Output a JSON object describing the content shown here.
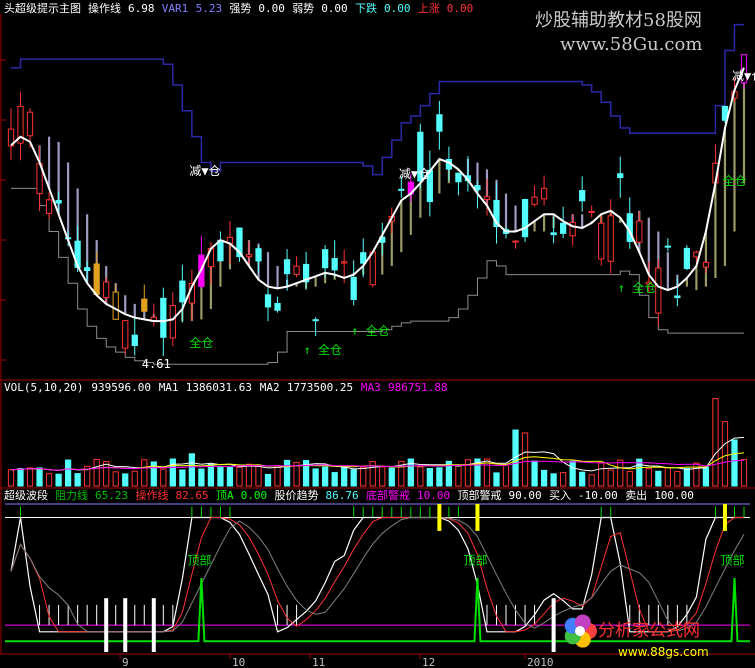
{
  "colors": {
    "background": "#000000",
    "up": "#ff3232",
    "down": "#54ffff",
    "main_line": "#ffffff",
    "stop_line": "#2a2aa8",
    "support_line": "#8c8c8c",
    "ribbon_down": "#b9b9e6",
    "ribbon_up": "#b5b57a",
    "signal_pink": "#ff00ff",
    "signal_gold": "#e0a020",
    "green": "#00e000",
    "yellow": "#ffff00",
    "panel_frame": "#a00000"
  },
  "main_panel": {
    "header": [
      {
        "text": "头超级提示主图",
        "color": "#ffffff"
      },
      {
        "text": "操作线",
        "color": "#ffffff"
      },
      {
        "text": "6.98",
        "color": "#ffffff"
      },
      {
        "text": "VAR1",
        "color": "#8080ff"
      },
      {
        "text": "5.23",
        "color": "#8080ff"
      },
      {
        "text": "强势",
        "color": "#ffffff"
      },
      {
        "text": "0.00",
        "color": "#ffffff"
      },
      {
        "text": "弱势",
        "color": "#ffffff"
      },
      {
        "text": "0.00",
        "color": "#ffffff"
      },
      {
        "text": "下跌",
        "color": "#54ffff"
      },
      {
        "text": "0.00",
        "color": "#54ffff"
      },
      {
        "text": "上涨",
        "color": "#ff3232"
      },
      {
        "text": "0.00",
        "color": "#ff3232"
      }
    ],
    "annotations": [
      {
        "text": "减▼仓",
        "color": "#ffffff"
      },
      {
        "text": "减▼仓",
        "color": "#ffffff"
      },
      {
        "text": "减▼仓",
        "color": "#ffffff"
      },
      {
        "text": "全仓",
        "color": "#00e000"
      },
      {
        "text": "↑ 全仓",
        "color": "#00e000"
      },
      {
        "text": "↑ 全仓",
        "color": "#00e000"
      },
      {
        "text": "↑ 全仓",
        "color": "#00e000"
      },
      {
        "text": "全仓",
        "color": "#00e000"
      },
      {
        "text": "4.61",
        "color": "#ffffff"
      }
    ]
  },
  "volume_panel": {
    "header": [
      {
        "text": "VOL(5,10,20)",
        "color": "#ffffff"
      },
      {
        "text": "939596.00",
        "color": "#ffffff"
      },
      {
        "text": "MA1",
        "color": "#ffffff"
      },
      {
        "text": "1386031.63",
        "color": "#ffffff"
      },
      {
        "text": "MA2",
        "color": "#ffffff"
      },
      {
        "text": "1773500.25",
        "color": "#ffffff"
      },
      {
        "text": "MA3",
        "color": "#ff00ff"
      },
      {
        "text": "986751.88",
        "color": "#ff00ff"
      }
    ]
  },
  "indicator_panel": {
    "header": [
      {
        "text": "超级波段",
        "color": "#ffffff"
      },
      {
        "text": "阻力线",
        "color": "#00c000"
      },
      {
        "text": "65.23",
        "color": "#00c000"
      },
      {
        "text": "操作线",
        "color": "#ff3232"
      },
      {
        "text": "82.65",
        "color": "#ff3232"
      },
      {
        "text": "顶A",
        "color": "#00ff00"
      },
      {
        "text": "0.00",
        "color": "#00ff00"
      },
      {
        "text": "股价趋势",
        "color": "#ffffff"
      },
      {
        "text": "86.76",
        "color": "#54ffff"
      },
      {
        "text": "底部警戒",
        "color": "#ff00ff"
      },
      {
        "text": "10.00",
        "color": "#ff00ff"
      },
      {
        "text": "顶部警戒",
        "color": "#ffffff"
      },
      {
        "text": "90.00",
        "color": "#ffffff"
      },
      {
        "text": "买入",
        "color": "#ffffff"
      },
      {
        "text": "-10.00",
        "color": "#ffffff"
      },
      {
        "text": "卖出",
        "color": "#ffffff"
      },
      {
        "text": "100.00",
        "color": "#ffffff"
      }
    ],
    "top_labels": [
      "顶部",
      "顶部",
      "顶部"
    ]
  },
  "x_axis": {
    "labels": [
      "9",
      "10",
      "11",
      "12",
      "2010"
    ]
  },
  "watermark": {
    "top_line1": "炒股辅助教材58股网",
    "top_line2": "www.58Gu.com",
    "bottom_line1": "分析家公式网",
    "bottom_line2": "www.88gs.com"
  },
  "chart_data": [
    {
      "type": "candlestick",
      "title": "头超级提示主图",
      "note": "Daily candlesticks with trend line; values estimated from pixels (price scale unlabeled except low marker 4.61).",
      "low_marker": 4.61,
      "trend_line": [
        5.8,
        5.85,
        5.82,
        5.7,
        5.55,
        5.4,
        5.25,
        5.1,
        5.0,
        4.93,
        4.88,
        4.85,
        4.82,
        4.8,
        4.79,
        4.78,
        4.78,
        4.79,
        4.85,
        4.98,
        5.08,
        5.2,
        5.25,
        5.23,
        5.18,
        5.1,
        5.02,
        4.98,
        4.97,
        4.98,
        5.0,
        5.02,
        5.04,
        5.06,
        5.05,
        5.03,
        5.05,
        5.1,
        5.18,
        5.28,
        5.38,
        5.48,
        5.52,
        5.58,
        5.65,
        5.72,
        5.7,
        5.66,
        5.6,
        5.52,
        5.45,
        5.35,
        5.3,
        5.3,
        5.32,
        5.36,
        5.4,
        5.4,
        5.36,
        5.33,
        5.32,
        5.35,
        5.4,
        5.42,
        5.38,
        5.3,
        5.18,
        5.05,
        4.98,
        4.96,
        4.98,
        5.03,
        5.1,
        5.3,
        5.58,
        5.9,
        6.12,
        6.25
      ],
      "signals": [
        "减仓",
        "减仓",
        "减仓",
        "全仓",
        "全仓",
        "全仓",
        "全仓",
        "全仓"
      ]
    },
    {
      "type": "bar",
      "title": "VOL(5,10,20)",
      "series": [
        {
          "name": "VOL",
          "last": 939596.0
        },
        {
          "name": "MA1",
          "last": 1386031.63
        },
        {
          "name": "MA2",
          "last": 1773500.25
        },
        {
          "name": "MA3",
          "last": 986751.88
        }
      ]
    },
    {
      "type": "line",
      "title": "超级波段",
      "ylim": [
        -10,
        100
      ],
      "series": [
        {
          "name": "阻力线",
          "last": 65.23
        },
        {
          "name": "操作线",
          "last": 82.65
        },
        {
          "name": "顶A",
          "last": 0.0
        },
        {
          "name": "股价趋势",
          "last": 86.76
        },
        {
          "name": "底部警戒",
          "last": 10.0
        },
        {
          "name": "顶部警戒",
          "last": 90.0
        },
        {
          "name": "买入",
          "last": -10.0
        },
        {
          "name": "卖出",
          "last": 100.0
        }
      ]
    }
  ]
}
